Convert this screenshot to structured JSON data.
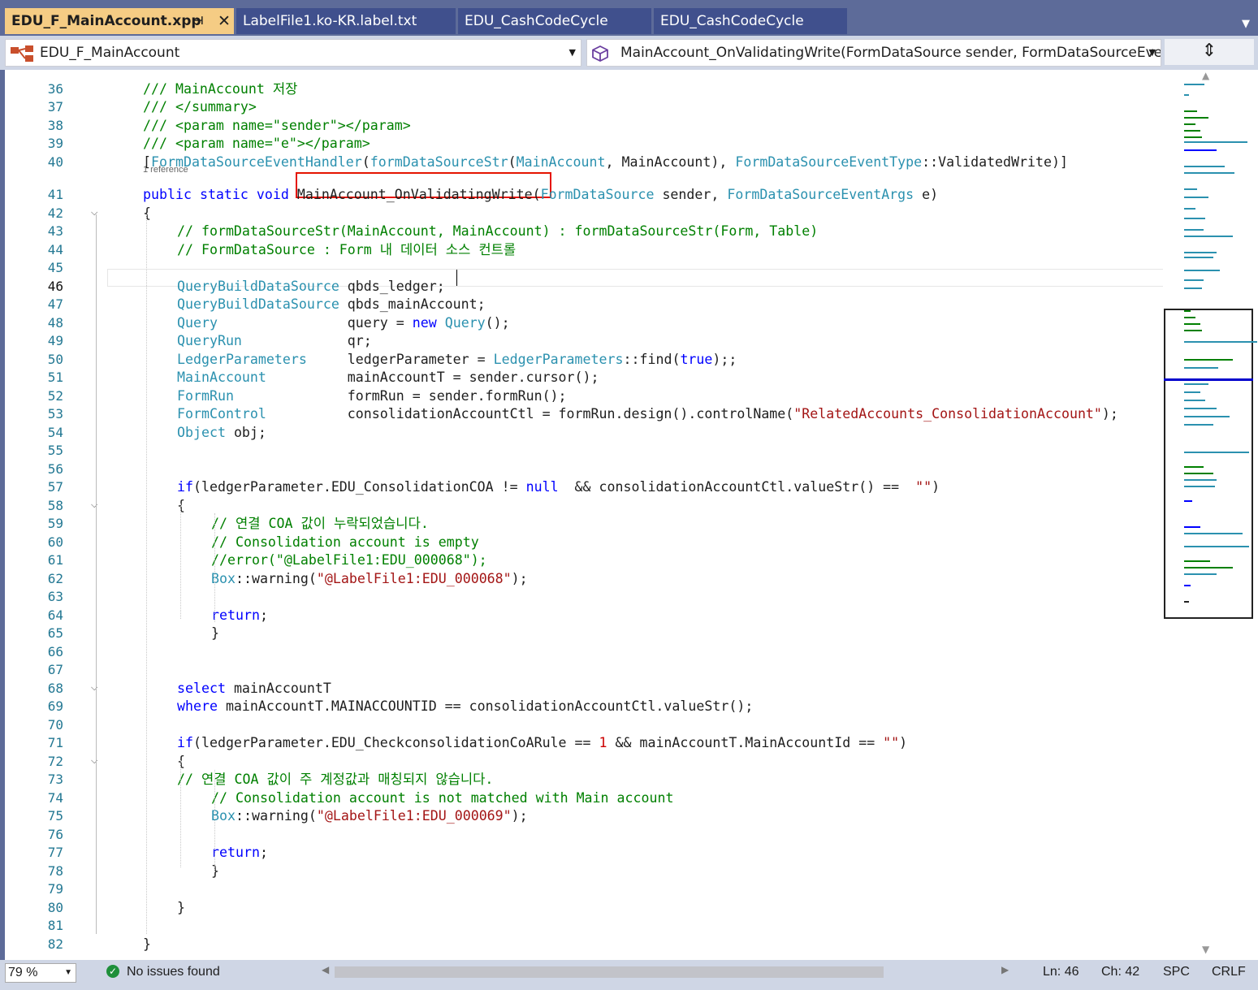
{
  "tabs": [
    {
      "label": "EDU_F_MainAccount.xpp",
      "active": true
    },
    {
      "label": "LabelFile1.ko-KR.label.txt"
    },
    {
      "label": "EDU_CashCodeCycle"
    },
    {
      "label": "EDU_CashCodeCycle"
    }
  ],
  "nav": {
    "class_dropdown": "EDU_F_MainAccount",
    "member_dropdown": "MainAccount_OnValidatingWrite(FormDataSource sender, FormDataSourceEventA"
  },
  "code_lens": "1 reference",
  "lines": [
    {
      "n": "36",
      "code": "/// MainAccount 저장"
    },
    {
      "n": "37",
      "code": "/// </summary>"
    },
    {
      "n": "38",
      "code": "/// <param name=\"sender\"></param>"
    },
    {
      "n": "39",
      "code": "/// <param name=\"e\"></param>"
    },
    {
      "n": "40",
      "code": "[FormDataSourceEventHandler(formDataSourceStr(MainAccount, MainAccount), FormDataSourceEventType::ValidatedWrite)]"
    },
    {
      "n": "41",
      "code": "public static void MainAccount_OnValidatingWrite(FormDataSource sender, FormDataSourceEventArgs e)"
    },
    {
      "n": "42",
      "code": "{"
    },
    {
      "n": "43",
      "code": "// formDataSourceStr(MainAccount, MainAccount) : formDataSourceStr(Form, Table)"
    },
    {
      "n": "44",
      "code": "// FormDataSource : Form 내 데이터 소스 컨트롤"
    },
    {
      "n": "45",
      "code": ""
    },
    {
      "n": "46",
      "code": "QueryBuildDataSource qbds_ledger;"
    },
    {
      "n": "47",
      "code": "QueryBuildDataSource qbds_mainAccount;"
    },
    {
      "n": "48",
      "code": "Query                query = new Query();"
    },
    {
      "n": "49",
      "code": "QueryRun             qr;"
    },
    {
      "n": "50",
      "code": "LedgerParameters     ledgerParameter = LedgerParameters::find(true);;"
    },
    {
      "n": "51",
      "code": "MainAccount          mainAccountT = sender.cursor();"
    },
    {
      "n": "52",
      "code": "FormRun              formRun = sender.formRun();"
    },
    {
      "n": "53",
      "code": "FormControl          consolidationAccountCtl = formRun.design().controlName(\"RelatedAccounts_ConsolidationAccount\");"
    },
    {
      "n": "54",
      "code": "Object obj;"
    },
    {
      "n": "55",
      "code": ""
    },
    {
      "n": "56",
      "code": ""
    },
    {
      "n": "57",
      "code": "if(ledgerParameter.EDU_ConsolidationCOA != null  && consolidationAccountCtl.valueStr() ==  \"\")"
    },
    {
      "n": "58",
      "code": "{"
    },
    {
      "n": "59",
      "code": "// 연결 COA 값이 누락되었습니다."
    },
    {
      "n": "60",
      "code": "// Consolidation account is empty"
    },
    {
      "n": "61",
      "code": "//error(\"@LabelFile1:EDU_000068\");"
    },
    {
      "n": "62",
      "code": "Box::warning(\"@LabelFile1:EDU_000068\");"
    },
    {
      "n": "63",
      "code": ""
    },
    {
      "n": "64",
      "code": "return;"
    },
    {
      "n": "65",
      "code": "}"
    },
    {
      "n": "66",
      "code": ""
    },
    {
      "n": "67",
      "code": ""
    },
    {
      "n": "68",
      "code": "select mainAccountT"
    },
    {
      "n": "69",
      "code": "where mainAccountT.MAINACCOUNTID == consolidationAccountCtl.valueStr();"
    },
    {
      "n": "70",
      "code": ""
    },
    {
      "n": "71",
      "code": "if(ledgerParameter.EDU_CheckconsolidationCoARule == 1 && mainAccountT.MainAccountId == \"\")"
    },
    {
      "n": "72",
      "code": "{"
    },
    {
      "n": "73",
      "code": "// 연결 COA 값이 주 계정값과 매칭되지 않습니다."
    },
    {
      "n": "74",
      "code": "// Consolidation account is not matched with Main account"
    },
    {
      "n": "75",
      "code": "Box::warning(\"@LabelFile1:EDU_000069\");"
    },
    {
      "n": "76",
      "code": ""
    },
    {
      "n": "77",
      "code": "return;"
    },
    {
      "n": "78",
      "code": "}"
    },
    {
      "n": "79",
      "code": ""
    },
    {
      "n": "80",
      "code": "}"
    },
    {
      "n": "81",
      "code": ""
    },
    {
      "n": "82",
      "code": "}"
    }
  ],
  "current_line": "46",
  "status": {
    "zoom": "79 %",
    "issues": "No issues found",
    "ln": "Ln: 46",
    "ch": "Ch: 42",
    "spc": "SPC",
    "crlf": "CRLF"
  },
  "colors": {
    "keyword": "#0000ff",
    "type": "#2b91af",
    "comment": "#008000",
    "string": "#a31515",
    "number": "#cc0000",
    "highlight_box": "#e51400",
    "active_tab": "#f5cc84"
  }
}
